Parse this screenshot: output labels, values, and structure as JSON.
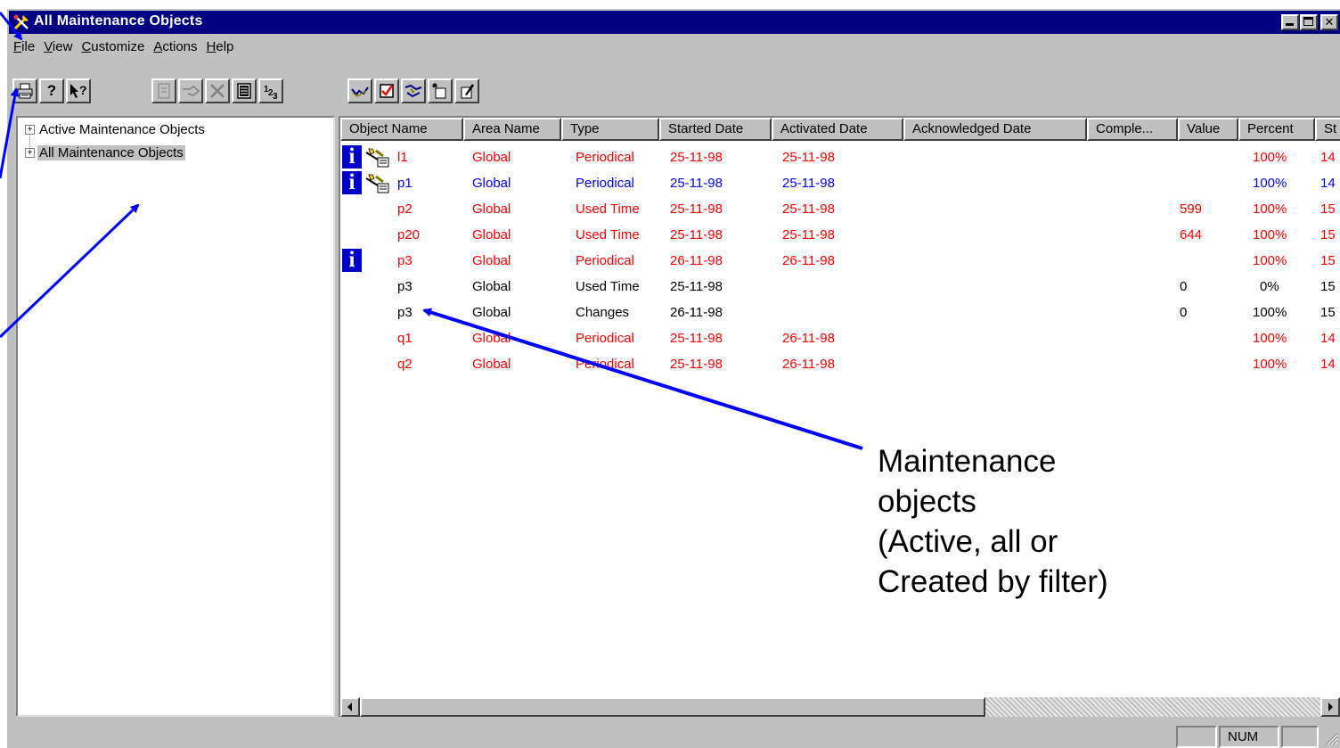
{
  "window": {
    "title": "All Maintenance Objects"
  },
  "menu": [
    {
      "label": "File",
      "hotkey": "F"
    },
    {
      "label": "View",
      "hotkey": "V"
    },
    {
      "label": "Customize",
      "hotkey": "C"
    },
    {
      "label": "Actions",
      "hotkey": "A"
    },
    {
      "label": "Help",
      "hotkey": "H"
    }
  ],
  "toolbar": {
    "print_icon": "printer-icon",
    "help_icon": "question-icon",
    "context_help_icon": "context-help-icon",
    "properties_icon": "properties-icon",
    "disabled_icons": [
      "properties-icon",
      "hand-icon",
      "delete-icon"
    ],
    "notes_icon": "notepad-icon",
    "numbering_icon": "numbering-icon",
    "numbering_label": "1",
    "view_icons": [
      "acknowledge-icon",
      "complete-icon",
      "handshake-icon",
      "new-object-icon",
      "edit-object-icon"
    ]
  },
  "tree": {
    "items": [
      {
        "label": "Active Maintenance Objects",
        "expander": "+",
        "selected": false
      },
      {
        "label": "All Maintenance Objects",
        "expander": "+",
        "selected": true
      }
    ]
  },
  "table": {
    "columns": [
      "Object Name",
      "Area Name",
      "Type",
      "Started Date",
      "Activated Date",
      "Acknowledged Date",
      "Comple...",
      "Value",
      "Percent",
      "St"
    ],
    "rows": [
      {
        "info": true,
        "tool": true,
        "color": "#ff0000",
        "name": "l1",
        "area": "Global",
        "type": "Periodical",
        "started": "25-11-98",
        "activated": "25-11-98",
        "acknowledged": "",
        "completed": "",
        "value": "",
        "percent": "100%",
        "st": "14"
      },
      {
        "info": true,
        "tool": true,
        "color": "#0000ff",
        "name": "p1",
        "area": "Global",
        "type": "Periodical",
        "started": "25-11-98",
        "activated": "25-11-98",
        "acknowledged": "",
        "completed": "",
        "value": "",
        "percent": "100%",
        "st": "14"
      },
      {
        "info": false,
        "tool": false,
        "color": "#ff0000",
        "name": "p2",
        "area": "Global",
        "type": "Used Time",
        "started": "25-11-98",
        "activated": "25-11-98",
        "acknowledged": "",
        "completed": "",
        "value": "599",
        "percent": "100%",
        "st": "15"
      },
      {
        "info": false,
        "tool": false,
        "color": "#ff0000",
        "name": "p20",
        "area": "Global",
        "type": "Used Time",
        "started": "25-11-98",
        "activated": "25-11-98",
        "acknowledged": "",
        "completed": "",
        "value": "644",
        "percent": "100%",
        "st": "15"
      },
      {
        "info": true,
        "tool": false,
        "color": "#ff0000",
        "name": "p3",
        "area": "Global",
        "type": "Periodical",
        "started": "26-11-98",
        "activated": "26-11-98",
        "acknowledged": "",
        "completed": "",
        "value": "",
        "percent": "100%",
        "st": "15"
      },
      {
        "info": false,
        "tool": false,
        "color": "#000000",
        "name": "p3",
        "area": "Global",
        "type": "Used Time",
        "started": "25-11-98",
        "activated": "",
        "acknowledged": "",
        "completed": "",
        "value": "0",
        "percent": "0%",
        "st": "15"
      },
      {
        "info": false,
        "tool": false,
        "color": "#000000",
        "name": "p3",
        "area": "Global",
        "type": "Changes",
        "started": "26-11-98",
        "activated": "",
        "acknowledged": "",
        "completed": "",
        "value": "0",
        "percent": "100%",
        "st": "15"
      },
      {
        "info": false,
        "tool": false,
        "color": "#ff0000",
        "name": "q1",
        "area": "Global",
        "type": "Periodical",
        "started": "25-11-98",
        "activated": "26-11-98",
        "acknowledged": "",
        "completed": "",
        "value": "",
        "percent": "100%",
        "st": "14"
      },
      {
        "info": false,
        "tool": false,
        "color": "#ff0000",
        "name": "q2",
        "area": "Global",
        "type": "Periodical",
        "started": "25-11-98",
        "activated": "26-11-98",
        "acknowledged": "",
        "completed": "",
        "value": "",
        "percent": "100%",
        "st": "14"
      }
    ]
  },
  "statusbar": {
    "num": "NUM"
  },
  "annotation": {
    "lines": [
      "Maintenance",
      "objects",
      "(Active, all or",
      "Created by filter)"
    ],
    "arrow_color": "#0000ff"
  },
  "colors": {
    "titlebar": "#000080",
    "face": "#c0c0c0",
    "info_icon": "#0000c8"
  }
}
